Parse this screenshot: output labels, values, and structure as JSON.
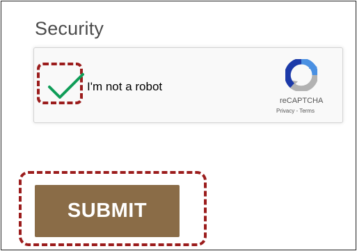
{
  "form": {
    "section_title": "Security",
    "submit_label": "SUBMIT"
  },
  "recaptcha": {
    "checkbox_checked": true,
    "label": "I'm not a robot",
    "brand": "reCAPTCHA",
    "links": "Privacy - Terms"
  },
  "colors": {
    "accent_button": "#8a6c47",
    "highlight_dashes": "#9b1c1c",
    "checkmark": "#0f9d58",
    "recaptcha_blue": "#4a90e2",
    "recaptcha_gray": "#b2b2b2"
  },
  "icons": {
    "checkmark": "checkmark-icon",
    "recaptcha": "recaptcha-logo-icon"
  }
}
